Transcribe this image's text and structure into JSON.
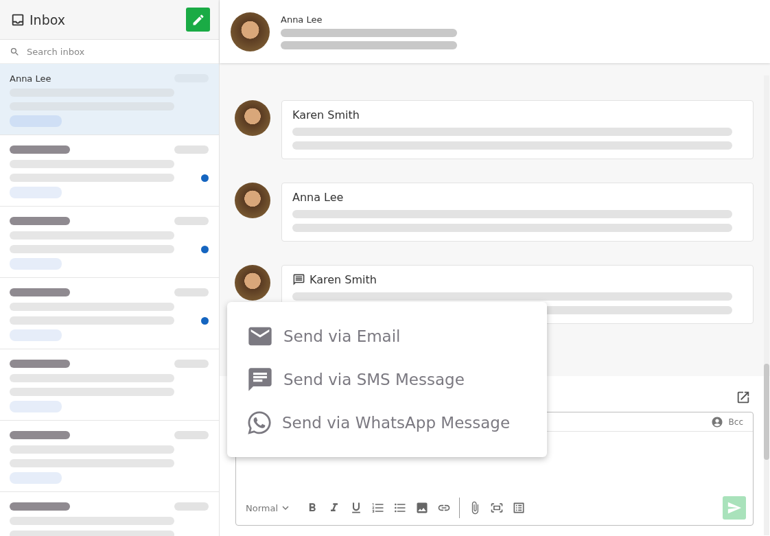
{
  "sidebar": {
    "title": "Inbox",
    "search": {
      "placeholder": "Search inbox"
    },
    "conversations": [
      {
        "name": "Anna Lee",
        "selected": true,
        "unread": false
      },
      {
        "selected": false,
        "unread": true
      },
      {
        "selected": false,
        "unread": true
      },
      {
        "selected": false,
        "unread": true
      },
      {
        "selected": false,
        "unread": false
      },
      {
        "selected": false,
        "unread": false
      },
      {
        "selected": false,
        "unread": false
      }
    ]
  },
  "conversation_header": {
    "name": "Anna Lee"
  },
  "messages": [
    {
      "sender": "Karen Smith",
      "kind": "email"
    },
    {
      "sender": "Anna Lee",
      "kind": "email"
    },
    {
      "sender": "Karen Smith",
      "kind": "sms"
    }
  ],
  "send_menu": {
    "items": [
      {
        "label": "Send via Email",
        "kind": "email"
      },
      {
        "label": "Send via SMS Message",
        "kind": "sms"
      },
      {
        "label": "Send via WhatsApp Message",
        "kind": "whatsapp"
      }
    ]
  },
  "composer": {
    "bcc": "Bcc",
    "format": "Normal",
    "send": {
      "disabled": true
    }
  }
}
